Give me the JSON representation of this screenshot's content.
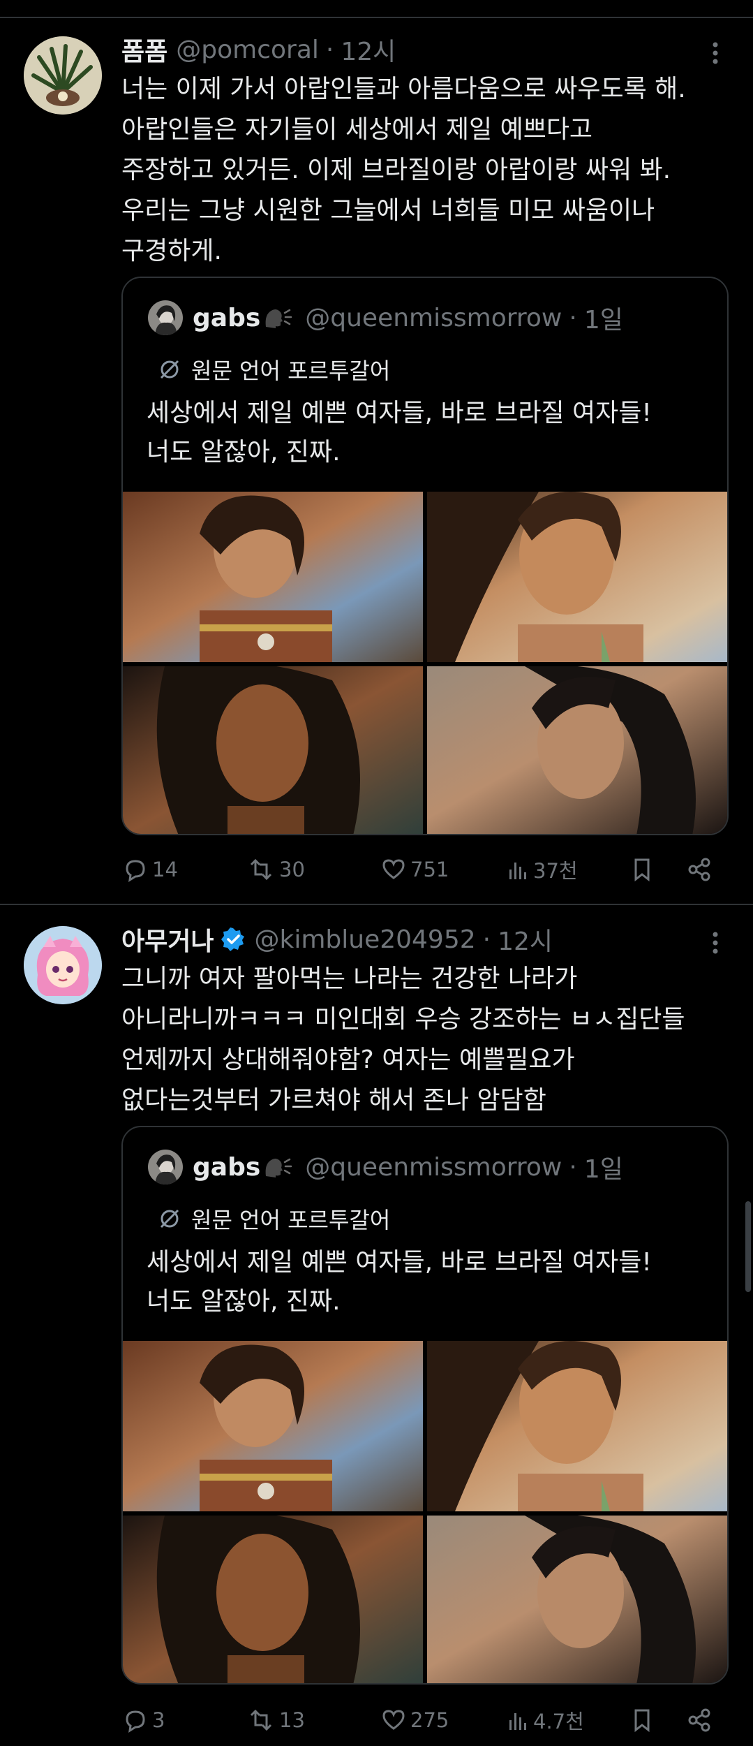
{
  "tweets": [
    {
      "name": "폼폼",
      "handle": "@pomcoral",
      "time": "12시",
      "lines": [
        "너는 이제 가서 아랍인들과 아름다움으로 싸우도록 해.",
        "아랍인들은 자기들이 세상에서 제일 예쁘다고",
        "주장하고 있거든. 이제 브라질이랑 아랍이랑 싸워 봐.",
        "우리는 그냥 시원한 그늘에서 너희들 미모 싸움이나",
        "구경하게."
      ],
      "verified": false,
      "quote": {
        "name": "gabs",
        "handle": "@queenmissmorrow",
        "time": "1일",
        "translate_label": "원문 언어 포르투갈어",
        "lines": [
          "세상에서 제일 예쁜 여자들, 바로 브라질 여자들!",
          "너도 알잖아, 진짜."
        ]
      },
      "stats": {
        "replies": "14",
        "retweets": "30",
        "likes": "751",
        "views": "37천"
      }
    },
    {
      "name": "아무거나",
      "handle": "@kimblue204952",
      "time": "12시",
      "lines": [
        "그니까 여자 팔아먹는 나라는 건강한 나라가",
        "아니라니까ㅋㅋㅋ 미인대회 우승 강조하는 ㅂㅅ집단들",
        "언제까지 상대해줘야함? 여자는 예쁠필요가",
        "없다는것부터 가르쳐야 해서 존나 암담함"
      ],
      "verified": true,
      "quote": {
        "name": "gabs",
        "handle": "@queenmissmorrow",
        "time": "1일",
        "translate_label": "원문 언어 포르투갈어",
        "lines": [
          "세상에서 제일 예쁜 여자들, 바로 브라질 여자들!",
          "너도 알잖아, 진짜."
        ]
      },
      "stats": {
        "replies": "3",
        "retweets": "13",
        "likes": "275",
        "views": "4.7천"
      }
    }
  ],
  "colors": {
    "background": "#000000",
    "text": "#e7e9ea",
    "muted": "#71767b",
    "border": "#2f3336",
    "verified": "#1d9bf0"
  },
  "icons": [
    "more-icon",
    "reply-icon",
    "retweet-icon",
    "like-icon",
    "views-icon",
    "bookmark-icon",
    "share-icon",
    "translate-icon",
    "verified-badge-icon"
  ]
}
